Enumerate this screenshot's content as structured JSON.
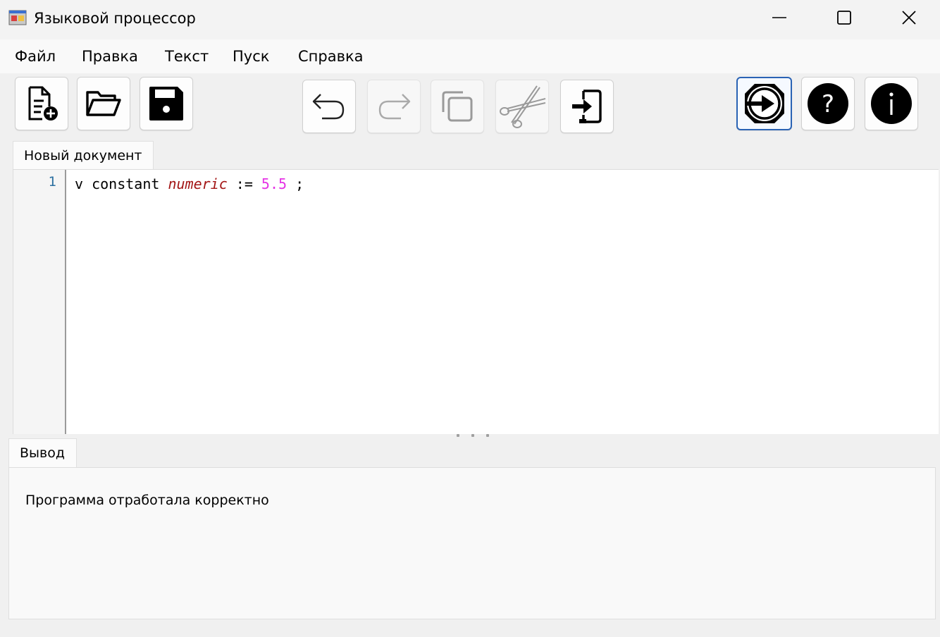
{
  "window": {
    "title": "Языковой процессор",
    "icon": "app-window-icon",
    "controls": [
      "minimize-icon",
      "maximize-icon",
      "close-icon"
    ]
  },
  "menu": {
    "file": "Файл",
    "edit": "Правка",
    "text": "Текст",
    "run": "Пуск",
    "help": "Справка"
  },
  "toolbar": {
    "buttons": [
      {
        "name": "new-document",
        "icon": "new-document-icon",
        "enabled": true
      },
      {
        "name": "open-file",
        "icon": "folder-open-icon",
        "enabled": true
      },
      {
        "name": "save-file",
        "icon": "floppy-disk-icon",
        "enabled": true
      },
      {
        "name": "undo",
        "icon": "undo-arrow-icon",
        "enabled": true
      },
      {
        "name": "redo",
        "icon": "redo-arrow-icon",
        "enabled": false
      },
      {
        "name": "copy",
        "icon": "copy-icon",
        "enabled": false
      },
      {
        "name": "cut",
        "icon": "scissors-icon",
        "enabled": false
      },
      {
        "name": "paste",
        "icon": "paste-icon",
        "enabled": true
      },
      {
        "name": "run",
        "icon": "run-arrow-circle-icon",
        "enabled": true
      },
      {
        "name": "help",
        "icon": "question-circle-icon",
        "enabled": true
      },
      {
        "name": "about",
        "icon": "info-circle-icon",
        "enabled": true
      }
    ]
  },
  "editor": {
    "tab_label": "Новый документ",
    "lines": [
      {
        "number": "1",
        "tokens": {
          "t1": "v constant ",
          "t2": "numeric",
          "t3": " := ",
          "t4": "5.5",
          "t5": " ;"
        }
      }
    ]
  },
  "output": {
    "tab_label": "Вывод",
    "message": "Программа отработала корректно"
  },
  "colors": {
    "keyword_type": "#a31515",
    "number_literal": "#e533e5",
    "line_number": "#2b6fa0",
    "active_border": "#2a63b4"
  }
}
